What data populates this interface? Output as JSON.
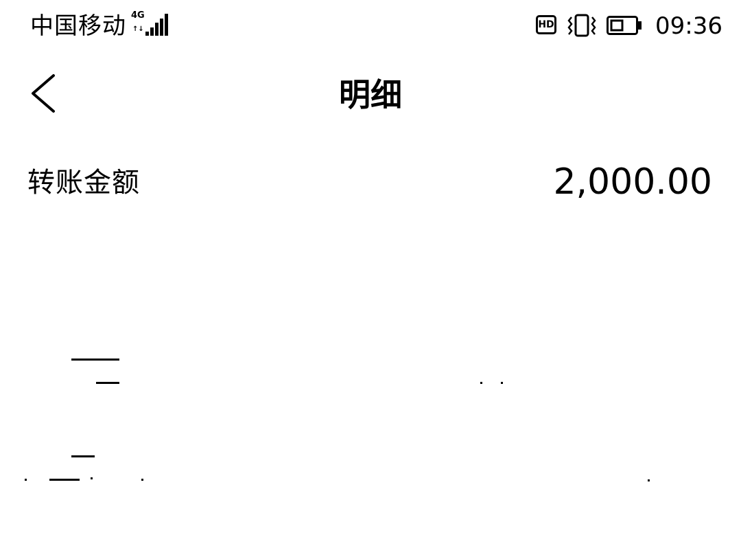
{
  "status_bar": {
    "carrier": "中国移动",
    "network_type": "4G",
    "network_activity": "↑↓",
    "signal_bars": 5,
    "hd_label": "HD",
    "vibrate_icon": "vibrate-icon",
    "battery_icon": "battery-icon",
    "time": "09:36"
  },
  "header": {
    "back_icon": "chevron-left-icon",
    "title": "明细"
  },
  "detail": {
    "label": "转账金额",
    "value": "2,000.00"
  }
}
